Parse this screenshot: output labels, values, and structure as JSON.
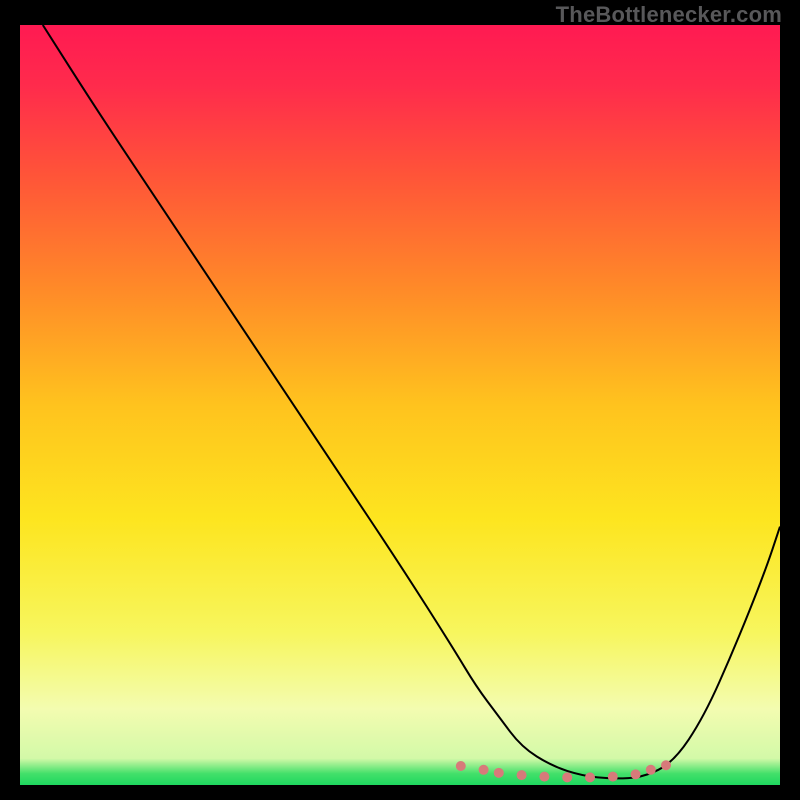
{
  "watermark": "TheBottlenecker.com",
  "chart_data": {
    "type": "line",
    "title": "",
    "xlabel": "",
    "ylabel": "",
    "xlim": [
      0,
      100
    ],
    "ylim": [
      0,
      100
    ],
    "grid": false,
    "axes_visible": false,
    "background_gradient": {
      "stops": [
        {
          "t": 0.0,
          "color": "#ff1a52"
        },
        {
          "t": 0.08,
          "color": "#ff2b4c"
        },
        {
          "t": 0.2,
          "color": "#ff5538"
        },
        {
          "t": 0.35,
          "color": "#ff8b28"
        },
        {
          "t": 0.5,
          "color": "#ffc31e"
        },
        {
          "t": 0.65,
          "color": "#fde51f"
        },
        {
          "t": 0.8,
          "color": "#f7f65e"
        },
        {
          "t": 0.9,
          "color": "#f3fcb0"
        },
        {
          "t": 0.965,
          "color": "#d3f9a8"
        },
        {
          "t": 0.985,
          "color": "#43e06a"
        },
        {
          "t": 1.0,
          "color": "#1ed75f"
        }
      ]
    },
    "series": [
      {
        "name": "bottleneck-curve",
        "color": "#000000",
        "stroke_width": 2,
        "x": [
          3,
          10,
          18,
          26,
          34,
          42,
          50,
          57,
          60,
          63,
          66,
          70,
          74,
          78,
          82,
          86,
          90,
          94,
          98,
          100
        ],
        "values": [
          100,
          89,
          77,
          65,
          53,
          41,
          29,
          18,
          13,
          9,
          5,
          2.5,
          1.2,
          0.8,
          1.0,
          3,
          9,
          18,
          28,
          34
        ]
      },
      {
        "name": "min-band-dots",
        "color": "#d77a7a",
        "marker": "dot",
        "marker_radius": 5,
        "x": [
          58,
          61,
          63,
          66,
          69,
          72,
          75,
          78,
          81,
          83,
          85
        ],
        "values": [
          2.5,
          2.0,
          1.6,
          1.3,
          1.1,
          1.0,
          1.0,
          1.1,
          1.4,
          2.0,
          2.6
        ]
      }
    ]
  }
}
